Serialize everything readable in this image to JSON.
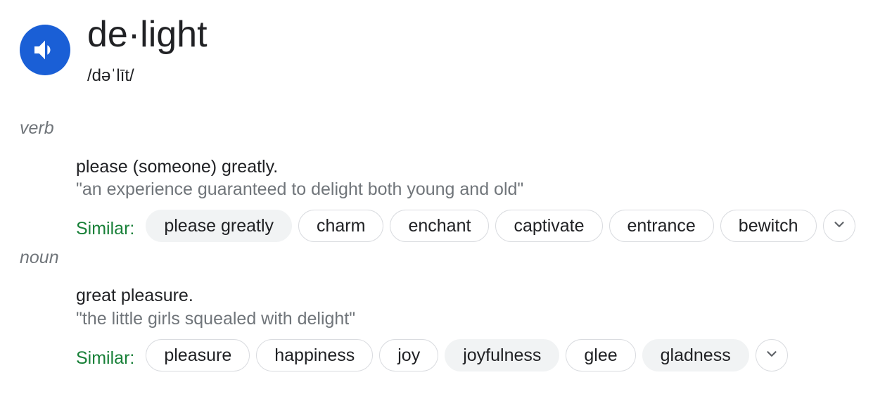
{
  "entry": {
    "headword": "de·light",
    "phonetic": "/dəˈlīt/"
  },
  "senses": [
    {
      "part_of_speech": "verb",
      "definition": "please (someone) greatly.",
      "example": "\"an experience guaranteed to delight both young and old\"",
      "similar_label": "Similar:",
      "similar": [
        "please greatly",
        "charm",
        "enchant",
        "captivate",
        "entrance",
        "bewitch"
      ]
    },
    {
      "part_of_speech": "noun",
      "definition": "great pleasure.",
      "example": "\"the little girls squealed with delight\"",
      "similar_label": "Similar:",
      "similar": [
        "pleasure",
        "happiness",
        "joy",
        "joyfulness",
        "glee",
        "gladness"
      ]
    }
  ],
  "icons": {
    "pronounce": "speaker-icon",
    "expand": "chevron-down-icon"
  },
  "colors": {
    "speaker_button": "#1a5fd6",
    "similar_label": "#188038",
    "muted_text": "#70757a",
    "chip_border": "#dadce0",
    "chip_filled": "#f1f3f4"
  }
}
